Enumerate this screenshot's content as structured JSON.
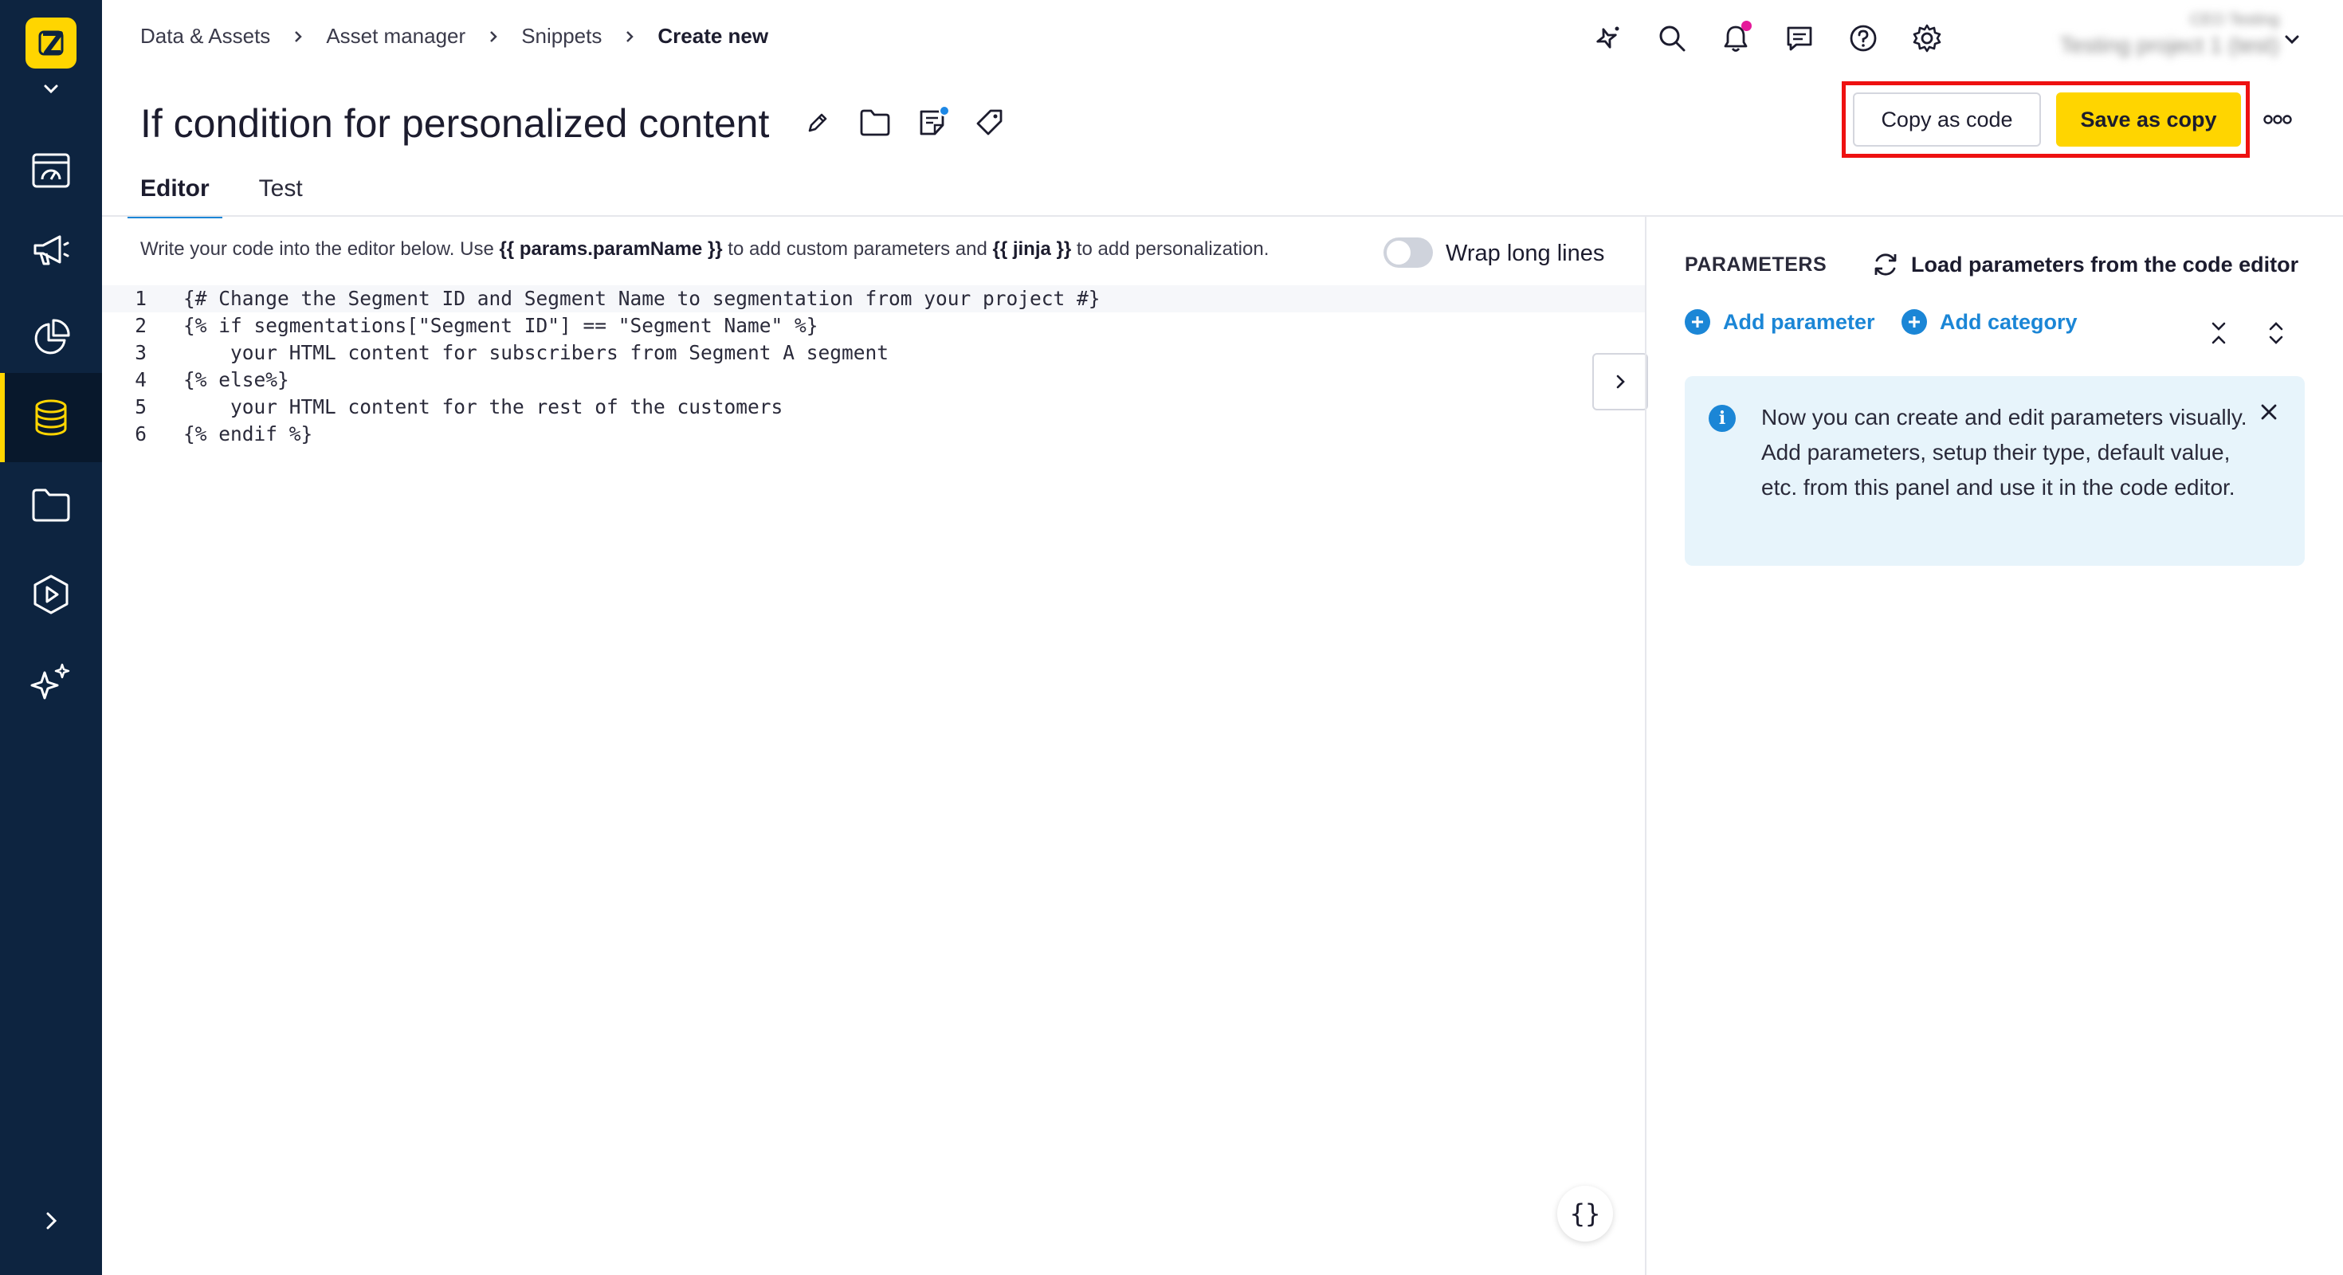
{
  "colors": {
    "rail_bg": "#0d2440",
    "brand_yellow": "#ffd500",
    "accent_blue": "#1b86d6",
    "highlight_red": "#ee1111",
    "notification_pink": "#e5199a",
    "info_bg": "#e7f4fb"
  },
  "rail": {
    "items": [
      {
        "icon": "dashboard-icon",
        "name": "rail-item-dashboards"
      },
      {
        "icon": "megaphone-icon",
        "name": "rail-item-campaigns"
      },
      {
        "icon": "pie-chart-icon",
        "name": "rail-item-analytics"
      },
      {
        "icon": "database-icon",
        "name": "rail-item-data-assets",
        "active": true
      },
      {
        "icon": "folder-icon",
        "name": "rail-item-files"
      },
      {
        "icon": "play-icon",
        "name": "rail-item-media"
      },
      {
        "icon": "sparkles-icon",
        "name": "rail-item-ai"
      }
    ]
  },
  "breadcrumb": {
    "items": [
      "Data & Assets",
      "Asset manager",
      "Snippets"
    ],
    "current": "Create new"
  },
  "topbar": {
    "icons": [
      "ai-assistant-icon",
      "search-icon",
      "bell-icon",
      "chat-icon",
      "help-icon",
      "gear-icon"
    ],
    "account_line1": "CEO Testing",
    "account_line2": "Testing project 1 (test)"
  },
  "page": {
    "title": "If condition for personalized content",
    "copy_as_code_label": "Copy as code",
    "save_as_copy_label": "Save as copy"
  },
  "tabs": [
    {
      "label": "Editor",
      "active": true
    },
    {
      "label": "Test",
      "active": false
    }
  ],
  "editor": {
    "hint_prefix": "Write your code into the editor below. Use ",
    "hint_param": "{{ params.paramName }}",
    "hint_middle": " to add custom parameters and ",
    "hint_jinja": "{{ jinja }}",
    "hint_suffix": " to add personalization.",
    "wrap_label": "Wrap long lines",
    "wrap_enabled": false,
    "lines": [
      {
        "n": "1",
        "text": "{# Change the Segment ID and Segment Name to segmentation from your project #}"
      },
      {
        "n": "2",
        "text": "{% if segmentations[\"Segment ID\"] == \"Segment Name\" %}"
      },
      {
        "n": "3",
        "text": "    your HTML content for subscribers from Segment A segment"
      },
      {
        "n": "4",
        "text": "{% else%}"
      },
      {
        "n": "5",
        "text": "    your HTML content for the rest of the customers"
      },
      {
        "n": "6",
        "text": "{% endif %}"
      }
    ],
    "format_button_label": "{}"
  },
  "parameters": {
    "title": "PARAMETERS",
    "load_label": "Load parameters from the code editor",
    "add_parameter_label": "Add parameter",
    "add_category_label": "Add category",
    "info_text": "Now you can create and edit parameters visually. Add parameters, setup their type, default value, etc. from this panel and use it in the code editor."
  }
}
